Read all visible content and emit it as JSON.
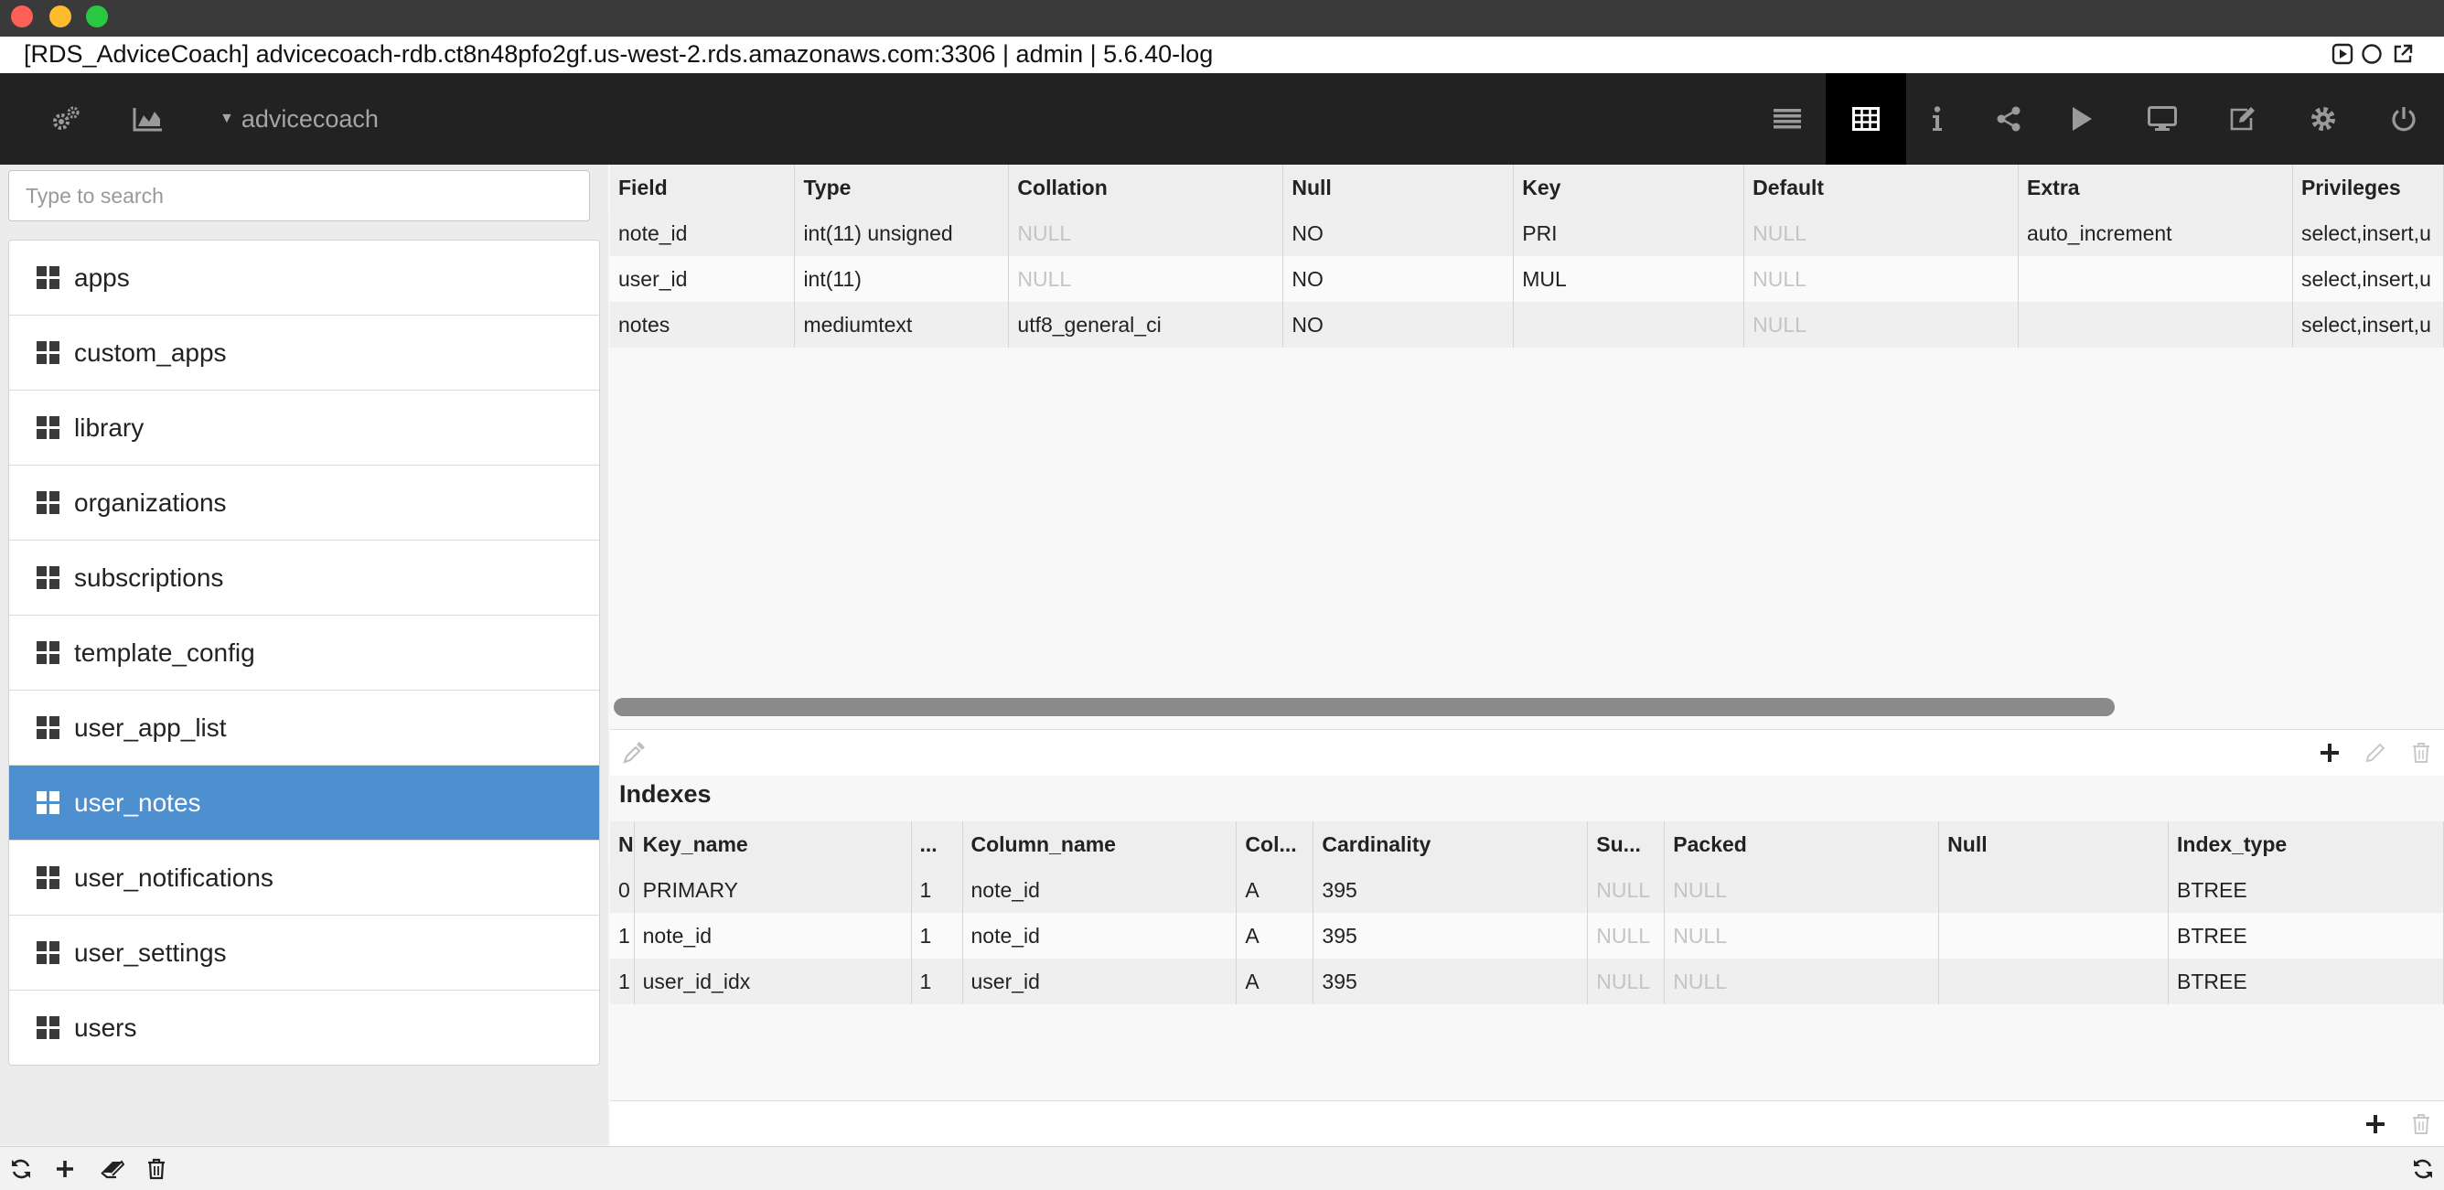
{
  "window": {
    "connection_title": "[RDS_AdviceCoach] advicecoach-rdb.ct8n48pfo2gf.us-west-2.rds.amazonaws.com:3306 | admin | 5.6.40-log"
  },
  "toolbar": {
    "database_name": "advicecoach",
    "left_icons": [
      "gears-icon",
      "area-chart-icon"
    ],
    "right_icons": [
      "list-icon",
      "table-icon",
      "info-icon",
      "share-icon",
      "play-icon",
      "monitor-icon",
      "edit-icon",
      "settings-icon",
      "power-icon"
    ],
    "active_view": "table-icon"
  },
  "sidebar": {
    "search_placeholder": "Type to search",
    "selected": "user_notes",
    "tables": [
      "apps",
      "custom_apps",
      "library",
      "organizations",
      "subscriptions",
      "template_config",
      "user_app_list",
      "user_notes",
      "user_notifications",
      "user_settings",
      "users"
    ]
  },
  "structure": {
    "columns": [
      "Field",
      "Type",
      "Collation",
      "Null",
      "Key",
      "Default",
      "Extra",
      "Privileges"
    ],
    "rows": [
      [
        "note_id",
        "int(11) unsigned",
        "NULL",
        "NO",
        "PRI",
        "NULL",
        "auto_increment",
        "select,insert,u"
      ],
      [
        "user_id",
        "int(11)",
        "NULL",
        "NO",
        "MUL",
        "NULL",
        "",
        "select,insert,u"
      ],
      [
        "notes",
        "mediumtext",
        "utf8_general_ci",
        "NO",
        "",
        "NULL",
        "",
        "select,insert,u"
      ]
    ]
  },
  "indexes": {
    "title": "Indexes",
    "columns": [
      "N",
      "Key_name",
      "...",
      "Column_name",
      "Col...",
      "Cardinality",
      "Su...",
      "Packed",
      "Null",
      "Index_type"
    ],
    "rows": [
      [
        "0",
        "PRIMARY",
        "1",
        "note_id",
        "A",
        "395",
        "NULL",
        "NULL",
        "",
        "BTREE"
      ],
      [
        "1",
        "note_id",
        "1",
        "note_id",
        "A",
        "395",
        "NULL",
        "NULL",
        "",
        "BTREE"
      ],
      [
        "1",
        "user_id_idx",
        "1",
        "user_id",
        "A",
        "395",
        "NULL",
        "NULL",
        "",
        "BTREE"
      ]
    ]
  },
  "null_text": "NULL",
  "colors": {
    "selection": "#4e8fd0",
    "toolbar_bg": "#222222",
    "null_text": "#c4c4c4"
  }
}
